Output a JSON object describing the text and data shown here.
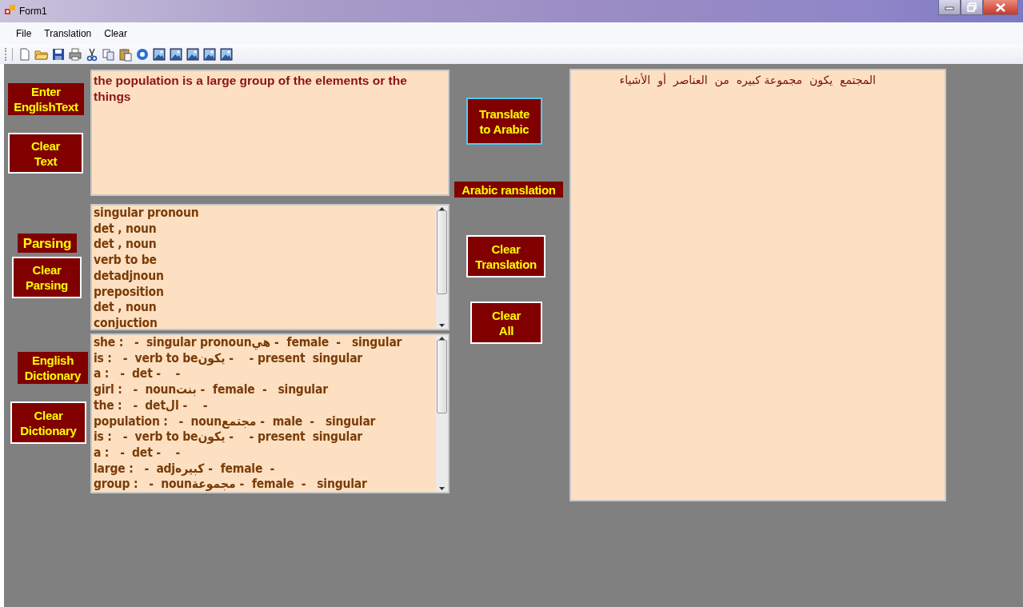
{
  "window": {
    "title": "Form1"
  },
  "menu": [
    "File",
    "Translation",
    "Clear"
  ],
  "english_input": {
    "label": "Enter\nEnglishText",
    "value": "the population is a large group of the elements or the things",
    "clear_button": "Clear\nText"
  },
  "parsing": {
    "label": "Parsing",
    "clear_button": "Clear\nParsing",
    "items": [
      "singular pronoun",
      "det , noun",
      "det , noun",
      "verb to be",
      "detadjnoun",
      "preposition",
      "det , noun",
      "conjuction"
    ]
  },
  "dictionary": {
    "label": "English\nDictionary",
    "clear_button": "Clear\nDictionary",
    "items": [
      "she :   -  singular pronounهي -  female  -   singular",
      "is :   -  verb to beيكون -    - present  singular",
      "a :   -  det -    -",
      "girl :   -  nounبنت -  female  -   singular",
      "the :   -  detال -    -",
      "population :   -  nounمجتمع -  male  -   singular",
      "is :   -  verb to beيكون -    - present  singular",
      "a :   -  det -    -",
      "large :   -  adjكبيره -  female  -",
      "group :   -  nounمجموعة -  female  -   singular"
    ]
  },
  "actions": [
    {
      "label": "Translate\nto Arabic",
      "focused": true
    }
  ],
  "translation": {
    "label": "Arabic ranslation",
    "value": "المجتمع  يكون  مجموعة كبيره  من  العناصر  أو  الأشياء"
  },
  "clear_actions": [
    {
      "label": "Clear\nTranslation",
      "focused": false
    },
    {
      "label": "Clear\nAll",
      "focused": false
    }
  ]
}
